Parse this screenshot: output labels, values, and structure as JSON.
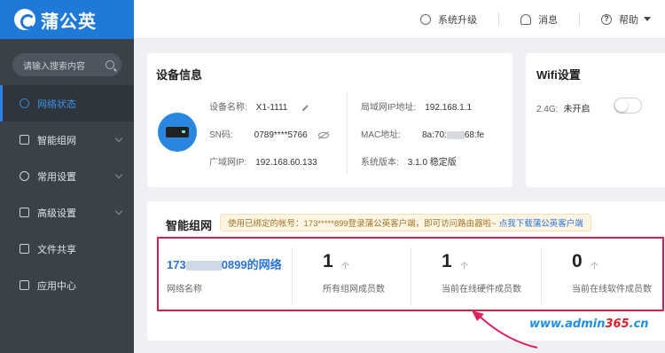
{
  "app": {
    "logo_text": "蒲公英"
  },
  "sidebar": {
    "search_placeholder": "请输入搜索内容",
    "items": [
      {
        "label": "网络状态",
        "icon": "network-status-icon",
        "active": true
      },
      {
        "label": "智能组网",
        "icon": "smart-network-icon"
      },
      {
        "label": "常用设置",
        "icon": "settings-icon"
      },
      {
        "label": "高级设置",
        "icon": "advanced-settings-icon"
      },
      {
        "label": "文件共享",
        "icon": "folder-icon"
      },
      {
        "label": "应用中心",
        "icon": "app-center-icon"
      }
    ]
  },
  "topbar": {
    "upgrade": "系统升级",
    "messages": "消息",
    "help": "帮助"
  },
  "device": {
    "title": "设备信息",
    "name_label": "设备名称:",
    "name_value": "X1-1111",
    "sn_label": "SN码:",
    "sn_value": "0789****5766",
    "wan_label": "广域网IP:",
    "wan_value": "192.168.60.133",
    "lan_label": "局域网IP地址:",
    "lan_value": "192.168.1.1",
    "mac_label": "MAC地址:",
    "mac_prefix": "8a:70:",
    "mac_suffix": "68:fe",
    "ver_label": "系统版本:",
    "ver_value": "3.1.0 稳定版"
  },
  "wifi": {
    "title": "Wifi设置",
    "band_label": "2.4G:",
    "band_status": "未开启",
    "enabled": false
  },
  "smartnet": {
    "title": "智能组网",
    "notice_text": "使用已绑定的帐号：173*****899登录蒲公英客户端，即可访问路由器啦~",
    "notice_link": "点我下载蒲公英客户端",
    "network_name_prefix": "173",
    "network_name_suffix": "0899的网络",
    "network_name_label": "网络名称",
    "stats": [
      {
        "value": "1",
        "unit": "个",
        "label": "所有组网成员数"
      },
      {
        "value": "1",
        "unit": "个",
        "label": "当前在线硬件成员数"
      },
      {
        "value": "0",
        "unit": "个",
        "label": "当前在线软件成员数"
      }
    ]
  },
  "watermark": {
    "prefix": "www.admin",
    "digits": "365",
    "suffix": ".cn"
  },
  "colors": {
    "accent": "#1f79d6",
    "sidebar": "#3a4149",
    "highlight_box": "#d5224b",
    "link": "#2a73d9"
  }
}
